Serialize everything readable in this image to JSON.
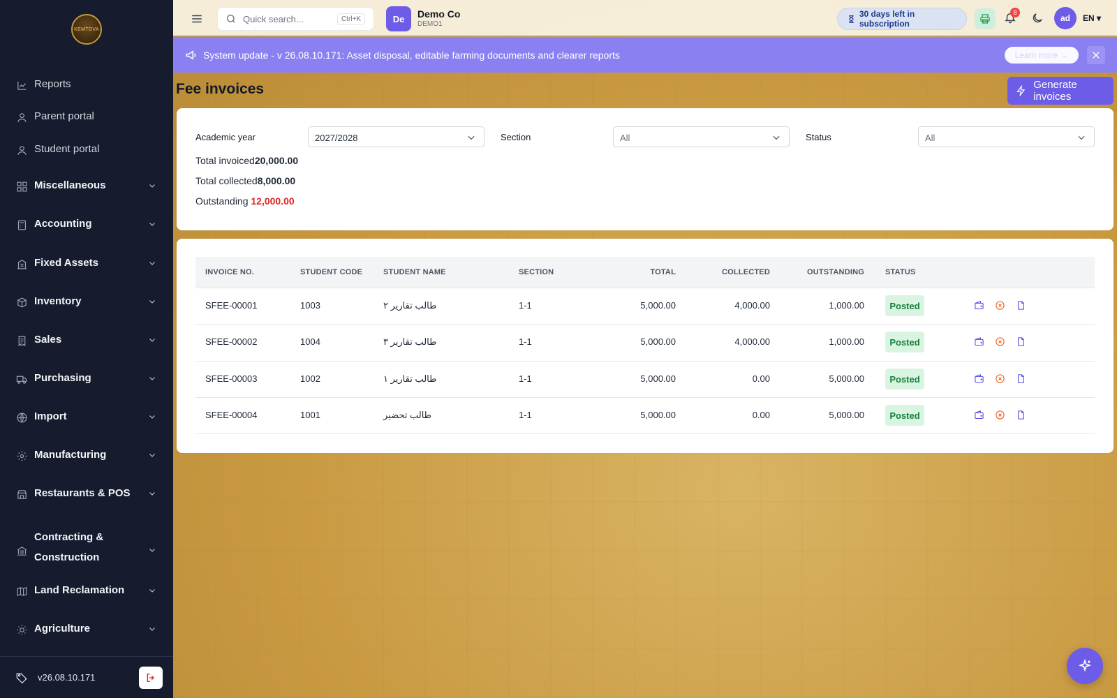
{
  "sidebar": {
    "logo_text": "KEMTOVA",
    "items": [
      {
        "label": "Reports",
        "icon": "chart-icon",
        "type": "plain"
      },
      {
        "label": "Parent portal",
        "icon": "user-icon",
        "type": "plain"
      },
      {
        "label": "Student portal",
        "icon": "user-icon",
        "type": "plain"
      },
      {
        "label": "Miscellaneous",
        "icon": "grid-icon",
        "type": "group"
      },
      {
        "label": "Accounting",
        "icon": "calculator-icon",
        "type": "group"
      },
      {
        "label": "Fixed Assets",
        "icon": "building-icon",
        "type": "group"
      },
      {
        "label": "Inventory",
        "icon": "box-icon",
        "type": "group"
      },
      {
        "label": "Sales",
        "icon": "receipt-icon",
        "type": "group"
      },
      {
        "label": "Purchasing",
        "icon": "truck-icon",
        "type": "group"
      },
      {
        "label": "Import",
        "icon": "globe-icon",
        "type": "group"
      },
      {
        "label": "Manufacturing",
        "icon": "gear-icon",
        "type": "group"
      },
      {
        "label": "Restaurants & POS",
        "icon": "store-icon",
        "type": "group"
      },
      {
        "label": "Contracting &",
        "label2": "Construction",
        "icon": "bank-icon",
        "type": "group"
      },
      {
        "label": "Land Reclamation",
        "icon": "map-icon",
        "type": "group"
      },
      {
        "label": "Agriculture",
        "icon": "sun-icon",
        "type": "group"
      }
    ],
    "version": "v26.08.10.171"
  },
  "topbar": {
    "search_placeholder": "Quick search...",
    "search_shortcut": "Ctrl+K",
    "company_initials": "De",
    "company_name": "Demo Co",
    "company_code": "DEMO1",
    "subscription": "30 days left in subscription",
    "notifications_count": "8",
    "user_initials": "ad",
    "language": "EN"
  },
  "announcement": {
    "message": "System update - v 26.08.10.171: Asset disposal, editable farming documents and clearer reports",
    "learn_more": "Learn more"
  },
  "page": {
    "title": "Fee invoices",
    "generate_button": "Generate invoices"
  },
  "filters": {
    "academic_year_label": "Academic year",
    "academic_year_value": "2027/2028",
    "section_label": "Section",
    "section_value": "All",
    "status_label": "Status",
    "status_value": "All"
  },
  "totals": {
    "invoiced_label": "Total invoiced",
    "invoiced_value": "20,000.00",
    "collected_label": "Total collected",
    "collected_value": "8,000.00",
    "outstanding_label": "Outstanding",
    "outstanding_value": "12,000.00"
  },
  "table": {
    "headers": [
      "INVOICE NO.",
      "STUDENT CODE",
      "STUDENT NAME",
      "SECTION",
      "TOTAL",
      "COLLECTED",
      "OUTSTANDING",
      "STATUS"
    ],
    "rows": [
      {
        "invoice": "SFEE-00001",
        "code": "1003",
        "name": "طالب تقارير ٢",
        "section": "1-1",
        "total": "5,000.00",
        "collected": "4,000.00",
        "outstanding": "1,000.00",
        "status": "Posted"
      },
      {
        "invoice": "SFEE-00002",
        "code": "1004",
        "name": "طالب تقارير ٣",
        "section": "1-1",
        "total": "5,000.00",
        "collected": "4,000.00",
        "outstanding": "1,000.00",
        "status": "Posted"
      },
      {
        "invoice": "SFEE-00003",
        "code": "1002",
        "name": "طالب تقارير ١",
        "section": "1-1",
        "total": "5,000.00",
        "collected": "0.00",
        "outstanding": "5,000.00",
        "status": "Posted"
      },
      {
        "invoice": "SFEE-00004",
        "code": "1001",
        "name": "طالب تحضير",
        "section": "1-1",
        "total": "5,000.00",
        "collected": "0.00",
        "outstanding": "5,000.00",
        "status": "Posted"
      }
    ]
  },
  "colors": {
    "sidebar_bg": "#161b2e",
    "accent": "#6d5ce7",
    "posted_bg": "#d9f5e2",
    "posted_text": "#15803d",
    "outstanding_red": "#dc2626"
  }
}
